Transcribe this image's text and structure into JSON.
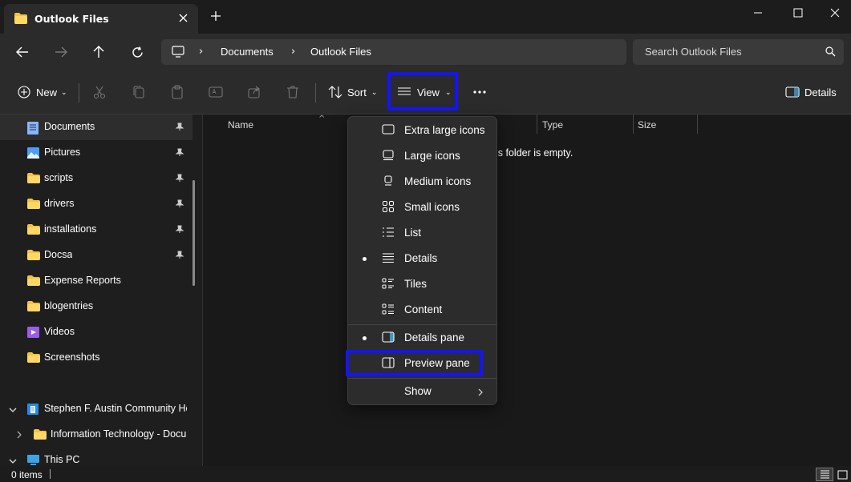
{
  "tab": {
    "title": "Outlook Files",
    "close_icon": "close-icon",
    "new_tab_icon": "plus-icon"
  },
  "window": {
    "minimize_icon": "minimize-icon",
    "maximize_icon": "maximize-icon",
    "close_icon": "close-icon"
  },
  "address": {
    "breadcrumbs": [
      "Documents",
      "Outlook Files"
    ],
    "search_placeholder": "Search Outlook Files"
  },
  "toolbar": {
    "new_label": "New",
    "sort_label": "Sort",
    "view_label": "View",
    "details_label": "Details"
  },
  "sidebar": {
    "items": [
      {
        "label": "Documents",
        "icon": "documents-icon",
        "pinned": true,
        "selected": true
      },
      {
        "label": "Pictures",
        "icon": "pictures-icon",
        "pinned": true
      },
      {
        "label": "scripts",
        "icon": "folder-icon",
        "pinned": true
      },
      {
        "label": "drivers",
        "icon": "folder-icon",
        "pinned": true
      },
      {
        "label": "installations",
        "icon": "folder-icon",
        "pinned": true
      },
      {
        "label": "Docsa",
        "icon": "folder-icon",
        "pinned": true
      },
      {
        "label": "Expense Reports",
        "icon": "folder-icon"
      },
      {
        "label": "blogentries",
        "icon": "folder-icon"
      },
      {
        "label": "Videos",
        "icon": "videos-icon"
      },
      {
        "label": "Screenshots",
        "icon": "folder-icon"
      }
    ],
    "tree": [
      {
        "label": "Stephen F. Austin Community He",
        "icon": "building-icon",
        "expanded": true
      },
      {
        "label": "Information Technology - Docur",
        "icon": "folder-icon",
        "expanded": false
      },
      {
        "label": "This PC",
        "icon": "pc-icon",
        "expanded": true
      }
    ]
  },
  "columns": [
    "Name",
    "Type",
    "Size"
  ],
  "empty_message": "is folder is empty.",
  "status": {
    "items": "0 items"
  },
  "view_menu": {
    "items": [
      {
        "label": "Extra large icons",
        "checked": false
      },
      {
        "label": "Large icons",
        "checked": false
      },
      {
        "label": "Medium icons",
        "checked": false
      },
      {
        "label": "Small icons",
        "checked": false
      },
      {
        "label": "List",
        "checked": false
      },
      {
        "label": "Details",
        "checked": true
      },
      {
        "label": "Tiles",
        "checked": false
      },
      {
        "label": "Content",
        "checked": false
      }
    ],
    "panes": [
      {
        "label": "Details pane",
        "checked": true
      },
      {
        "label": "Preview pane",
        "checked": false
      }
    ],
    "show_label": "Show"
  },
  "colors": {
    "highlight": "#1414ff",
    "folder": "#f5c242",
    "accent": "#4cc2ff"
  }
}
